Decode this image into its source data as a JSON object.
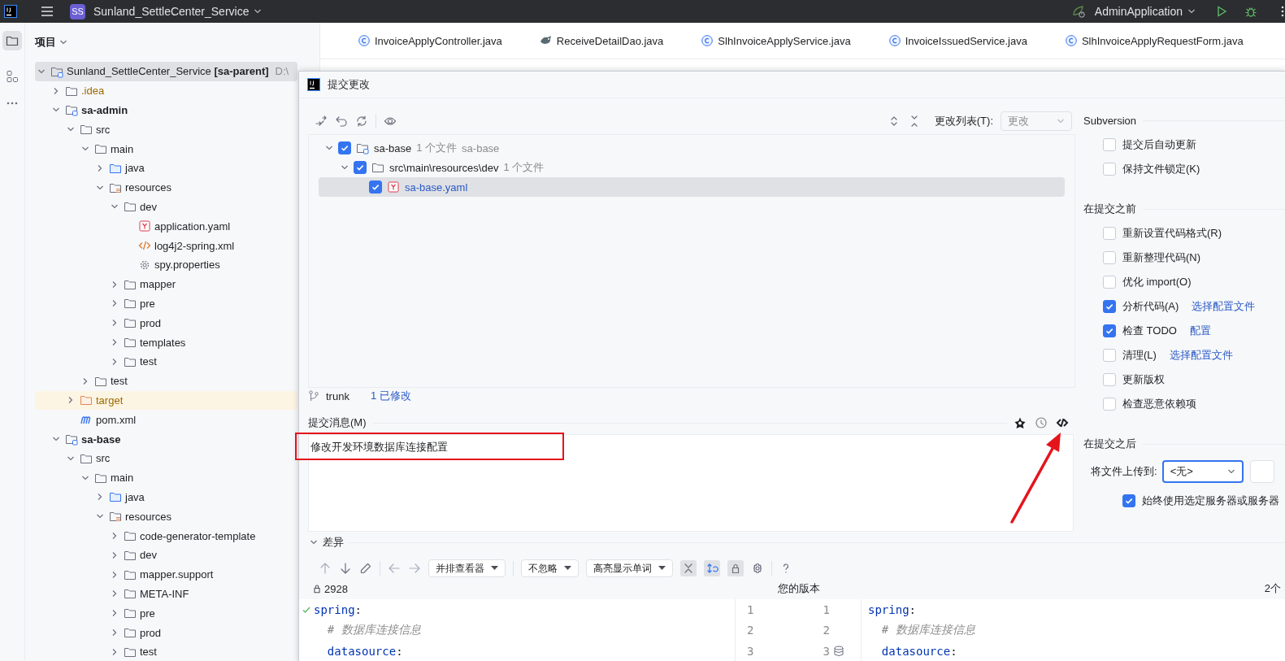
{
  "top_bar": {
    "project_badge": "SS",
    "project_name": "Sunland_SettleCenter_Service",
    "run_config": "AdminApplication"
  },
  "project_panel": {
    "title": "项目",
    "tree": [
      {
        "name": "Sunland_SettleCenter_Service **[sa-parent]**",
        "path": "D:\\",
        "kind": "root-module",
        "expanded": true,
        "selected": true,
        "children": [
          {
            "name": ".idea",
            "kind": "ignored-folder",
            "expanded": false,
            "selected": false
          },
          {
            "name": "sa-admin",
            "kind": "module",
            "expanded": true,
            "selected": false,
            "children": [
              {
                "name": "src",
                "kind": "folder",
                "expanded": true,
                "selected": false,
                "children": [
                  {
                    "name": "main",
                    "kind": "folder",
                    "expanded": true,
                    "selected": false,
                    "children": [
                      {
                        "name": "java",
                        "kind": "source",
                        "expanded": false,
                        "selected": false
                      },
                      {
                        "name": "resources",
                        "kind": "resources",
                        "expanded": true,
                        "selected": false,
                        "children": [
                          {
                            "name": "dev",
                            "kind": "folder",
                            "expanded": true,
                            "selected": false,
                            "children": [
                              {
                                "name": "application.yaml",
                                "kind": "yaml",
                                "selected": false
                              },
                              {
                                "name": "log4j2-spring.xml",
                                "kind": "xml",
                                "selected": false
                              },
                              {
                                "name": "spy.properties",
                                "kind": "properties",
                                "selected": false
                              }
                            ]
                          },
                          {
                            "name": "mapper",
                            "kind": "folder",
                            "expanded": false,
                            "selected": false
                          },
                          {
                            "name": "pre",
                            "kind": "folder",
                            "expanded": false,
                            "selected": false
                          },
                          {
                            "name": "prod",
                            "kind": "folder",
                            "expanded": false,
                            "selected": false
                          },
                          {
                            "name": "templates",
                            "kind": "folder",
                            "expanded": false,
                            "selected": false
                          },
                          {
                            "name": "test",
                            "kind": "folder",
                            "expanded": false,
                            "selected": false
                          }
                        ]
                      }
                    ]
                  },
                  {
                    "name": "test",
                    "kind": "folder",
                    "expanded": false,
                    "selected": false
                  }
                ]
              },
              {
                "name": "target",
                "kind": "excluded",
                "expanded": false,
                "selected": false
              },
              {
                "name": "pom.xml",
                "kind": "pom",
                "selected": false
              }
            ]
          },
          {
            "name": "sa-base",
            "kind": "module",
            "expanded": true,
            "selected": false,
            "children": [
              {
                "name": "src",
                "kind": "folder",
                "expanded": true,
                "selected": false,
                "children": [
                  {
                    "name": "main",
                    "kind": "folder",
                    "expanded": true,
                    "selected": false,
                    "children": [
                      {
                        "name": "java",
                        "kind": "source",
                        "expanded": false,
                        "selected": false
                      },
                      {
                        "name": "resources",
                        "kind": "resources",
                        "expanded": true,
                        "selected": false,
                        "children": [
                          {
                            "name": "code-generator-template",
                            "kind": "folder",
                            "expanded": false,
                            "selected": false
                          },
                          {
                            "name": "dev",
                            "kind": "folder",
                            "expanded": false,
                            "selected": false
                          },
                          {
                            "name": "mapper.support",
                            "kind": "folder",
                            "expanded": false,
                            "selected": false
                          },
                          {
                            "name": "META-INF",
                            "kind": "folder",
                            "expanded": false,
                            "selected": false
                          },
                          {
                            "name": "pre",
                            "kind": "folder",
                            "expanded": false,
                            "selected": false
                          },
                          {
                            "name": "prod",
                            "kind": "folder",
                            "expanded": false,
                            "selected": false
                          },
                          {
                            "name": "test",
                            "kind": "folder",
                            "expanded": false,
                            "selected": false
                          }
                        ]
                      }
                    ]
                  }
                ]
              }
            ]
          }
        ]
      }
    ]
  },
  "editor_tabs": [
    {
      "label": "InvoiceApplyController.java",
      "kind": "class",
      "selected": false
    },
    {
      "label": "ReceiveDetailDao.java",
      "kind": "dao",
      "selected": false
    },
    {
      "label": "SlhInvoiceApplyService.java",
      "kind": "class",
      "selected": false
    },
    {
      "label": "InvoiceIssuedService.java",
      "kind": "class",
      "selected": false
    },
    {
      "label": "SlhInvoiceApplyRequestForm.java",
      "kind": "class",
      "selected": false
    }
  ],
  "commit_dialog": {
    "title": "提交更改",
    "changelist_label": "更改列表(T):",
    "changelist_value": "更改",
    "changes": [
      {
        "name": "sa-base",
        "kind": "module",
        "checked": true,
        "expanded": true,
        "selected": false,
        "modified": false,
        "count": "1 个文件",
        "extra": "sa-base",
        "children": [
          {
            "name": "src\\main\\resources\\dev",
            "kind": "folder",
            "checked": true,
            "expanded": true,
            "selected": false,
            "modified": false,
            "count": "1 个文件",
            "children": [
              {
                "name": "sa-base.yaml",
                "kind": "yaml",
                "checked": true,
                "selected": true,
                "modified": true
              }
            ]
          }
        ]
      }
    ],
    "branch": "trunk",
    "modified_link": "1 已修改",
    "message_label": "提交消息(M)",
    "message": "修改开发环境数据库连接配置",
    "options": [
      {
        "title": "Subversion",
        "items": [
          {
            "label": "提交后自动更新",
            "checked": false
          },
          {
            "label": "保持文件锁定(K)",
            "checked": false
          }
        ]
      },
      {
        "title": "在提交之前",
        "items": [
          {
            "label": "重新设置代码格式(R)",
            "checked": false
          },
          {
            "label": "重新整理代码(N)",
            "checked": false
          },
          {
            "label": "优化 import(O)",
            "checked": false
          },
          {
            "label": "分析代码(A)",
            "checked": true,
            "link": "选择配置文件"
          },
          {
            "label": "检查 TODO",
            "checked": true,
            "link": "配置"
          },
          {
            "label": "清理(L)",
            "checked": false,
            "link": "选择配置文件"
          },
          {
            "label": "更新版权",
            "checked": false
          },
          {
            "label": "检查恶意依赖项",
            "checked": false
          }
        ]
      },
      {
        "title": "在提交之后",
        "upload": {
          "label": "将文件上传到:",
          "value": "<无>",
          "focused": true
        },
        "items": [
          {
            "label": "始终使用选定服务器或服务器",
            "checked": true
          }
        ]
      }
    ],
    "diff": {
      "title": "差异",
      "expanded": true,
      "viewer": "并排查看器",
      "ignore": "不忽略",
      "highlight": "高亮显示单词",
      "toggles": [
        {
          "kind": "collapse",
          "on": true
        },
        {
          "kind": "sync",
          "on": true
        },
        {
          "kind": "lock",
          "on": true
        }
      ],
      "left_title": "2928",
      "middle_title": "您的版本",
      "diff_count": "2个",
      "lines": [
        {
          "left_no": "1",
          "right_no": "1",
          "verified": true,
          "has_db_marker": false,
          "left": {
            "kind": "key",
            "text": "spring",
            "suffix": ":"
          },
          "right": {
            "kind": "key",
            "text": "spring",
            "suffix": ":"
          }
        },
        {
          "left_no": "2",
          "right_no": "2",
          "verified": false,
          "has_db_marker": false,
          "left": {
            "kind": "comment",
            "text": "  # 数据库连接信息"
          },
          "right": {
            "kind": "comment",
            "text": "  # 数据库连接信息"
          }
        },
        {
          "left_no": "3",
          "right_no": "3",
          "verified": false,
          "has_db_marker": true,
          "left": {
            "kind": "key",
            "text": "  datasource",
            "suffix": ":"
          },
          "right": {
            "kind": "key",
            "text": "  datasource",
            "suffix": ":"
          }
        }
      ]
    }
  }
}
